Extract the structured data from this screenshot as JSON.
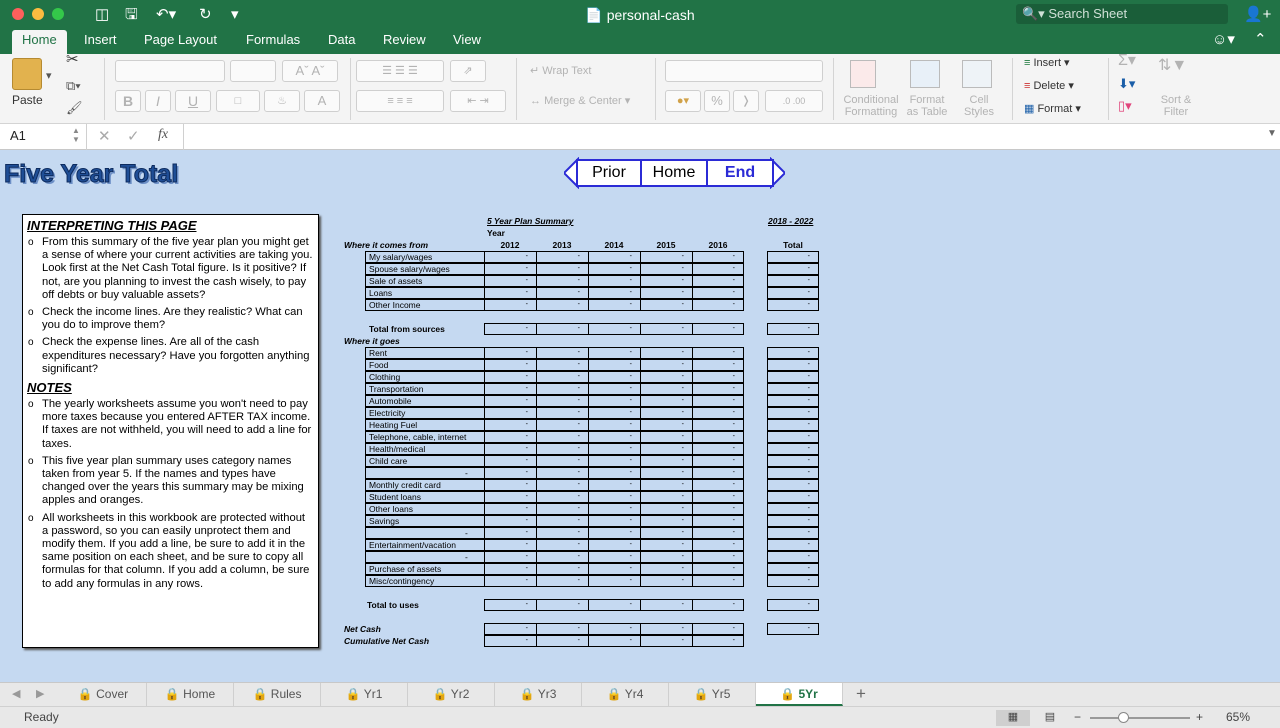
{
  "window": {
    "title": "personal-cash",
    "search_placeholder": "Search Sheet"
  },
  "ribbon_tabs": [
    "Home",
    "Insert",
    "Page Layout",
    "Formulas",
    "Data",
    "Review",
    "View"
  ],
  "ribbon": {
    "paste": "Paste",
    "wrap_text": "Wrap Text",
    "merge_center": "Merge & Center",
    "conditional": "Conditional",
    "conditional2": "Formatting",
    "format_as": "Format",
    "format_as2": "as Table",
    "cell": "Cell",
    "cell2": "Styles",
    "insert": "Insert",
    "delete": "Delete",
    "format": "Format",
    "sort": "Sort &",
    "sort2": "Filter",
    "percent": "%"
  },
  "formula_bar": {
    "cell_ref": "A1",
    "fx": "fx",
    "formula": ""
  },
  "sheet": {
    "title": "Five Year Total",
    "nav": {
      "prior": "Prior",
      "home": "Home",
      "end": "End"
    },
    "notes": {
      "heading1": "INTERPRETING THIS PAGE",
      "items1": [
        "From this summary of the five year plan you might get a sense of where your current activities are taking you. Look first at the Net Cash Total figure. Is it positive? If not, are you planning to invest the cash wisely, to pay off debts or buy valuable assets?",
        "Check the income lines. Are they realistic? What can you do to improve them?",
        "Check the expense lines. Are all of the cash expenditures necessary? Have you forgotten anything significant?"
      ],
      "heading2": "NOTES",
      "items2": [
        "The yearly worksheets assume you won't need to pay more taxes because you entered AFTER TAX income. If taxes are not withheld, you will need to add a line for taxes.",
        "This five year plan summary uses category names taken from year 5. If the names and types have changed over the years this summary may be mixing apples and oranges.",
        "All worksheets in this workbook are protected without a password, so you can easily unprotect them and modify them. If you add a line, be sure to add it in the same position on each sheet, and be sure to copy all formulas for that column. If you add a column, be sure to add any formulas in any rows."
      ]
    },
    "table": {
      "summary_title": "5 Year Plan Summary",
      "range_title": "2018 - 2022",
      "year_label": "Year",
      "comes_from": "Where it comes from",
      "years": [
        "2012",
        "2013",
        "2014",
        "2015",
        "2016"
      ],
      "total_label": "Total",
      "income_rows": [
        "My salary/wages",
        "Spouse salary/wages",
        "Sale of assets",
        "Loans",
        "Other Income"
      ],
      "total_sources": "Total from sources",
      "goes": "Where it goes",
      "expense_rows": [
        "Rent",
        "Food",
        "Clothing",
        "Transportation",
        "Automobile",
        "Electricity",
        "Heating Fuel",
        "Telephone, cable, internet",
        "Health/medical",
        "Child care",
        "-",
        "Monthly credit card",
        "Student loans",
        "Other loans",
        "Savings",
        "-",
        "Entertainment/vacation",
        "-",
        "Purchase of assets",
        "Misc/contingency"
      ],
      "total_uses": "Total to uses",
      "net_cash": "Net Cash",
      "cumulative": "Cumulative Net Cash",
      "dash": "-"
    }
  },
  "sheet_tabs": [
    "Cover",
    "Home",
    "Rules",
    "Yr1",
    "Yr2",
    "Yr3",
    "Yr4",
    "Yr5",
    "5Yr"
  ],
  "status": {
    "ready": "Ready",
    "zoom": "65%"
  },
  "colors": {
    "excel_green": "#217346",
    "sheet_bg": "#c5d9f1",
    "nav_border": "#2b2bd6"
  }
}
